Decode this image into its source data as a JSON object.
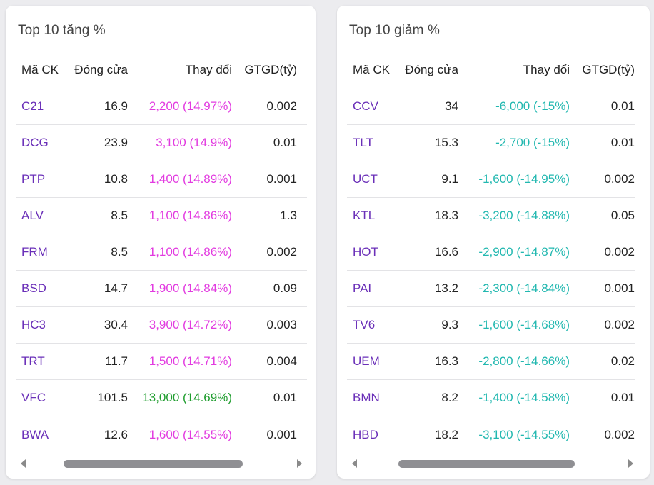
{
  "gainers": {
    "title": "Top 10 tăng %",
    "columns": [
      "Mã CK",
      "Đóng cửa",
      "Thay đổi",
      "GTGD(tỷ)"
    ],
    "rows": [
      {
        "symbol": "C21",
        "close": "16.9",
        "change": "2,200 (14.97%)",
        "value": "0.002",
        "tone": "up"
      },
      {
        "symbol": "DCG",
        "close": "23.9",
        "change": "3,100 (14.9%)",
        "value": "0.01",
        "tone": "up"
      },
      {
        "symbol": "PTP",
        "close": "10.8",
        "change": "1,400 (14.89%)",
        "value": "0.001",
        "tone": "up"
      },
      {
        "symbol": "ALV",
        "close": "8.5",
        "change": "1,100 (14.86%)",
        "value": "1.3",
        "tone": "up"
      },
      {
        "symbol": "FRM",
        "close": "8.5",
        "change": "1,100 (14.86%)",
        "value": "0.002",
        "tone": "up"
      },
      {
        "symbol": "BSD",
        "close": "14.7",
        "change": "1,900 (14.84%)",
        "value": "0.09",
        "tone": "up"
      },
      {
        "symbol": "HC3",
        "close": "30.4",
        "change": "3,900 (14.72%)",
        "value": "0.003",
        "tone": "up"
      },
      {
        "symbol": "TRT",
        "close": "11.7",
        "change": "1,500 (14.71%)",
        "value": "0.004",
        "tone": "up"
      },
      {
        "symbol": "VFC",
        "close": "101.5",
        "change": "13,000 (14.69%)",
        "value": "0.01",
        "tone": "ceil"
      },
      {
        "symbol": "BWA",
        "close": "12.6",
        "change": "1,600 (14.55%)",
        "value": "0.001",
        "tone": "up"
      }
    ]
  },
  "losers": {
    "title": "Top 10 giảm %",
    "columns": [
      "Mã CK",
      "Đóng cửa",
      "Thay đổi",
      "GTGD(tỷ)"
    ],
    "rows": [
      {
        "symbol": "CCV",
        "close": "34",
        "change": "-6,000 (-15%)",
        "value": "0.01",
        "tone": "down"
      },
      {
        "symbol": "TLT",
        "close": "15.3",
        "change": "-2,700 (-15%)",
        "value": "0.01",
        "tone": "down"
      },
      {
        "symbol": "UCT",
        "close": "9.1",
        "change": "-1,600 (-14.95%)",
        "value": "0.002",
        "tone": "down"
      },
      {
        "symbol": "KTL",
        "close": "18.3",
        "change": "-3,200 (-14.88%)",
        "value": "0.05",
        "tone": "down"
      },
      {
        "symbol": "HOT",
        "close": "16.6",
        "change": "-2,900 (-14.87%)",
        "value": "0.002",
        "tone": "down"
      },
      {
        "symbol": "PAI",
        "close": "13.2",
        "change": "-2,300 (-14.84%)",
        "value": "0.001",
        "tone": "down"
      },
      {
        "symbol": "TV6",
        "close": "9.3",
        "change": "-1,600 (-14.68%)",
        "value": "0.002",
        "tone": "down"
      },
      {
        "symbol": "UEM",
        "close": "16.3",
        "change": "-2,800 (-14.66%)",
        "value": "0.02",
        "tone": "down"
      },
      {
        "symbol": "BMN",
        "close": "8.2",
        "change": "-1,400 (-14.58%)",
        "value": "0.01",
        "tone": "down"
      },
      {
        "symbol": "HBD",
        "close": "18.2",
        "change": "-3,100 (-14.55%)",
        "value": "0.002",
        "tone": "down"
      }
    ]
  },
  "colors": {
    "symbol": "#6a2fb8",
    "up": "#e23be0",
    "ceil": "#1f9d2e",
    "down": "#22b8b0"
  },
  "icons": {
    "scroll_left": "caret-left-icon",
    "scroll_right": "caret-right-icon"
  }
}
